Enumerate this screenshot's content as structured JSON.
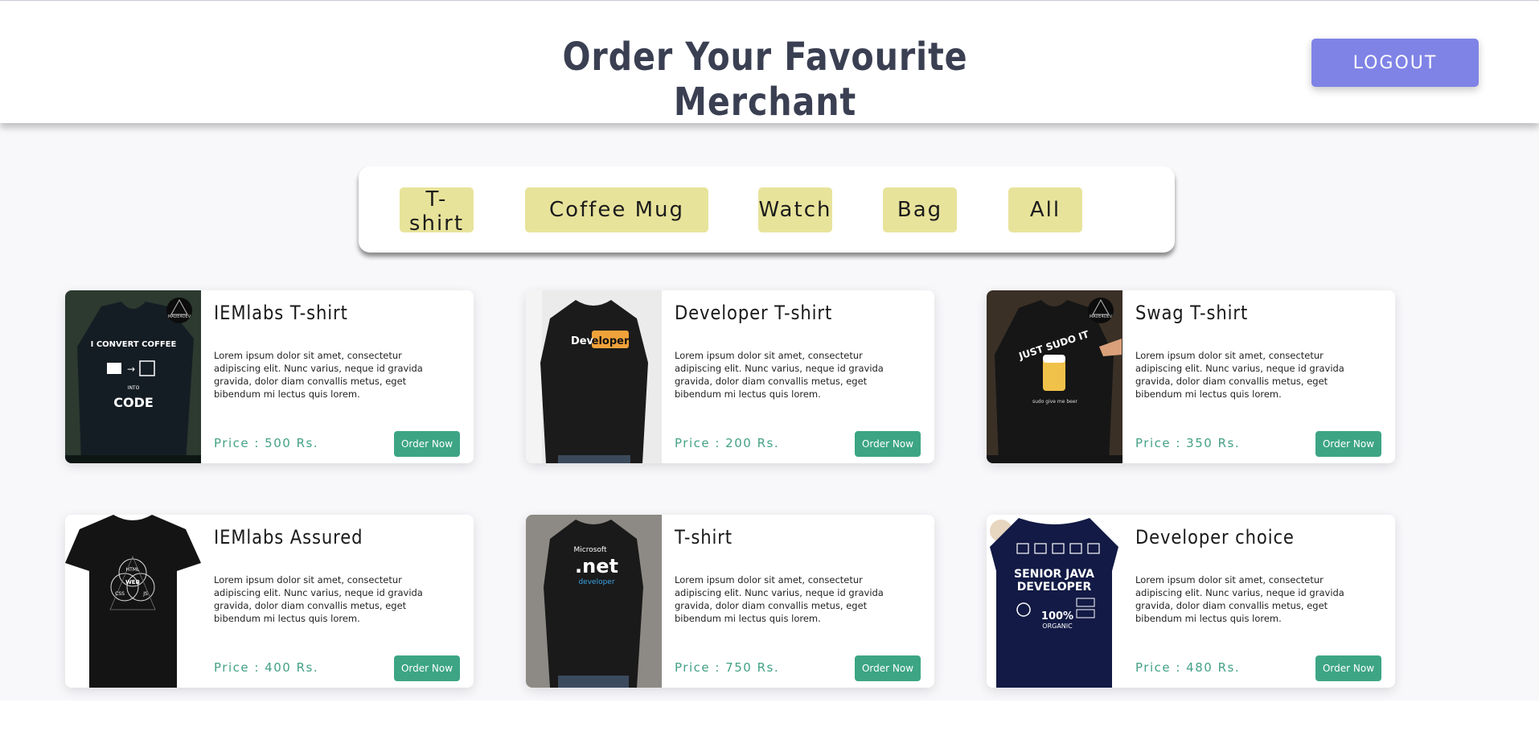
{
  "header": {
    "title": "Order Your Favourite Merchant",
    "logout_label": "LOGOUT"
  },
  "filters": [
    "T-shirt",
    "Coffee Mug",
    "Watch",
    "Bag",
    "All"
  ],
  "products": [
    {
      "title": "IEMlabs T-shirt",
      "description": "Lorem ipsum dolor sit amet, consectetur adipiscing elit. Nunc varius, neque id gravida gravida, dolor diam convallis metus, eget bibendum mi lectus quis lorem.",
      "price": "Price : 500 Rs.",
      "order_label": "Order Now",
      "image": {
        "shirt_color": "#151d24",
        "bg_color": "#2c3a30",
        "print_lines": [
          "I CONVERT COFFEE",
          "INTO",
          "CODE"
        ],
        "brand": "MADE4DEV"
      }
    },
    {
      "title": "Developer T-shirt",
      "description": "Lorem ipsum dolor sit amet, consectetur adipiscing elit. Nunc varius, neque id gravida gravida, dolor diam convallis metus, eget bibendum mi lectus quis lorem.",
      "price": "Price : 200 Rs.",
      "order_label": "Order Now",
      "image": {
        "shirt_color": "#1b1b1b",
        "bg_color": "#ebebeb",
        "print_text_a": "Dev",
        "print_text_b": "eloper"
      }
    },
    {
      "title": "Swag T-shirt",
      "description": "Lorem ipsum dolor sit amet, consectetur adipiscing elit. Nunc varius, neque id gravida gravida, dolor diam convallis metus, eget bibendum mi lectus quis lorem.",
      "price": "Price : 350 Rs.",
      "order_label": "Order Now",
      "image": {
        "shirt_color": "#161616",
        "bg_color": "#3a3026",
        "print_lines": [
          "JUST SUDO IT",
          "sudo give me beer"
        ],
        "brand": "MADE4DEV"
      }
    },
    {
      "title": "IEMlabs Assured",
      "description": "Lorem ipsum dolor sit amet, consectetur adipiscing elit. Nunc varius, neque id gravida gravida, dolor diam convallis metus, eget bibendum mi lectus quis lorem.",
      "price": "Price : 400 Rs.",
      "order_label": "Order Now",
      "image": {
        "shirt_color": "#141414",
        "bg_color": "#ffffff",
        "print_lines": [
          "HTML",
          "WEB",
          "CSS",
          "JS"
        ]
      }
    },
    {
      "title": "T-shirt",
      "description": "Lorem ipsum dolor sit amet, consectetur adipiscing elit. Nunc varius, neque id gravida gravida, dolor diam convallis metus, eget bibendum mi lectus quis lorem.",
      "price": "Price : 750 Rs.",
      "order_label": "Order Now",
      "image": {
        "shirt_color": "#1a1a1a",
        "bg_color": "#8d8a85",
        "print_lines": [
          "Microsoft",
          ".net",
          "developer"
        ]
      }
    },
    {
      "title": "Developer choice",
      "description": "Lorem ipsum dolor sit amet, consectetur adipiscing elit. Nunc varius, neque id gravida gravida, dolor diam convallis metus, eget bibendum mi lectus quis lorem.",
      "price": "Price : 480 Rs.",
      "order_label": "Order Now",
      "image": {
        "shirt_color": "#121a45",
        "bg_color": "#ffffff",
        "print_lines": [
          "SENIOR JAVA",
          "DEVELOPER",
          "100%",
          "ORGANIC"
        ]
      }
    }
  ]
}
